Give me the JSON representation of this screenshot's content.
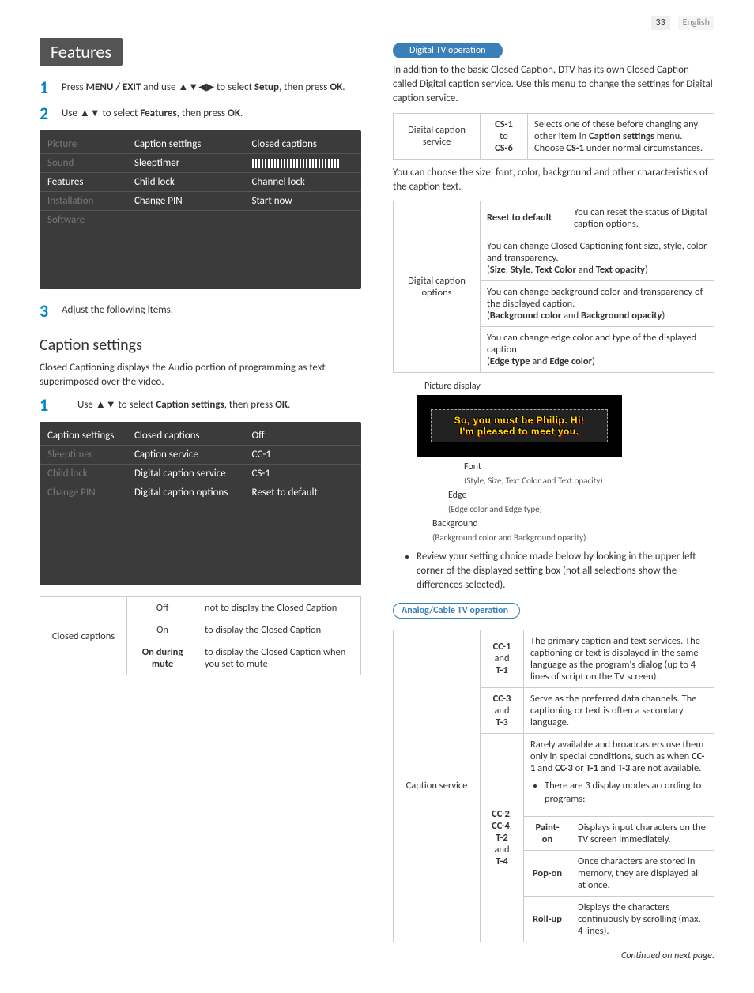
{
  "page": {
    "number": "33",
    "language": "English"
  },
  "left": {
    "features_title": "Features",
    "step1": {
      "text_a": "Press ",
      "bold_a": "MENU / EXIT",
      "text_b": " and use ",
      "arrows": "▲▼◀▶",
      "text_c": " to select ",
      "bold_b": "Setup",
      "text_d": ", then press ",
      "bold_c": "OK",
      "text_e": "."
    },
    "step2": {
      "text_a": "Use ",
      "arrows": "▲▼",
      "text_b": " to select ",
      "bold_a": "Features",
      "text_c": ", then press ",
      "bold_b": "OK",
      "text_d": "."
    },
    "menu1": {
      "r1": {
        "c1": "Picture",
        "c2": "Caption settings",
        "c3": "Closed captions"
      },
      "r2": {
        "c1": "Sound",
        "c2": "Sleeptimer"
      },
      "r3": {
        "c1": "Features",
        "c2": "Child lock",
        "c3": "Channel lock"
      },
      "r4": {
        "c1": "Installation",
        "c2": "Change PIN",
        "c3": "Start now"
      },
      "r5": {
        "c1": "Software"
      }
    },
    "step3": {
      "text": "Adjust the following items."
    },
    "caption_settings_title": "Caption settings",
    "caption_settings_intro": "Closed Captioning displays the Audio portion of programming as text superimposed over the video.",
    "caption_step1": {
      "text_a": "Use ",
      "arrows": "▲▼",
      "text_b": " to select ",
      "bold_a": "Caption settings",
      "text_c": ", then press ",
      "bold_b": "OK",
      "text_d": "."
    },
    "menu2": {
      "r1": {
        "c1": "Caption settings",
        "c2": "Closed captions",
        "c3": "Off"
      },
      "r2": {
        "c1": "Sleeptimer",
        "c2": "Caption service",
        "c3": "CC-1"
      },
      "r3": {
        "c1": "Child lock",
        "c2": "Digital caption service",
        "c3": "CS-1"
      },
      "r4": {
        "c1": "Change PIN",
        "c2": "Digital caption options",
        "c3": "Reset to default"
      }
    },
    "cc_table": {
      "header": "Closed captions",
      "rows": [
        {
          "opt": "Off",
          "desc": "not to display the Closed Caption"
        },
        {
          "opt": "On",
          "desc": "to display the Closed Caption"
        },
        {
          "opt": "On during mute",
          "desc": "to display the Closed Caption when you set to mute"
        }
      ]
    }
  },
  "right": {
    "digital_pill": "Digital TV operation",
    "digital_intro": "In addition to the basic Closed Caption, DTV has its own Closed Caption called Digital caption service. Use this menu to change the settings for Digital caption service.",
    "dcs_table": {
      "label": "Digital caption service",
      "val1": "CS-1",
      "val_mid": "to",
      "val2": "CS-6",
      "desc_a": "Selects one of these before changing any other item in ",
      "desc_b": "Caption settings",
      "desc_c": " menu. Choose ",
      "desc_d": "CS-1",
      "desc_e": " under normal circumstances."
    },
    "char_intro": "You can choose the size, font, color, background and other characteristics of the caption text.",
    "dco_table": {
      "label": "Digital caption options",
      "r1": {
        "a": "Reset to default",
        "b": "You can reset the status of Digital caption options."
      },
      "r2": {
        "text_a": "You can change Closed Captioning font size, style, color and transparency.",
        "text_b": "(",
        "b1": "Size",
        "s1": ", ",
        "b2": "Style",
        "s2": ", ",
        "b3": "Text Color",
        "s3": " and ",
        "b4": "Text opacity",
        "text_c": ")"
      },
      "r3": {
        "text_a": "You can change background color and transparency of the displayed caption.",
        "text_b": "(",
        "b1": "Background color",
        "s1": " and ",
        "b2": "Background opacity",
        "text_c": ")"
      },
      "r4": {
        "text_a": "You can change edge color and type of the displayed caption.",
        "text_b": "(",
        "b1": "Edge type",
        "s1": " and ",
        "b2": "Edge color",
        "text_c": ")"
      }
    },
    "pic_display_label": "Picture display",
    "tv_line1": "So, you must be Philip. Hi!",
    "tv_line2": "I'm pleased to meet you.",
    "font_label": "Font",
    "font_note": "(Style, Size, Text Color and Text opacity)",
    "edge_label": "Edge",
    "edge_note": "(Edge color and Edge type)",
    "bg_label": "Background",
    "bg_note": "(Background color and Background opacity)",
    "review_bullet": "Review your setting choice made below by looking in the upper left corner of the displayed setting box (not all selections show the differences selected).",
    "analog_pill": "Analog/Cable TV operation",
    "cs_table": {
      "label": "Caption service",
      "r1": {
        "val": "CC-1\nand\nT-1",
        "val_a": "CC-1",
        "val_b": "and",
        "val_c": "T-1",
        "desc": "The primary caption and text services. The captioning or text is displayed in the same language as the program's dialog (up to 4 lines of script on the TV screen)."
      },
      "r2": {
        "val_a": "CC-3",
        "val_b": "and",
        "val_c": "T-3",
        "desc": "Serve as the preferred data channels. The captioning or text is often a secondary language."
      },
      "r3": {
        "val_a": "CC-2",
        "val_a2": ",",
        "val_b": "CC-4",
        "val_b2": ",",
        "val_c": "T-2",
        "val_d": "and",
        "val_e": "T-4",
        "desc_a": "Rarely available and broadcasters use them only in special conditions, such as when ",
        "d_b1": "CC-1",
        "d_s1": " and ",
        "d_b2": "CC-3",
        "d_s2": " or ",
        "d_b3": "T-1",
        "d_s3": " and ",
        "d_b4": "T-3",
        "desc_b": " are not available.",
        "bullet": "There are 3 display modes according to programs:",
        "modes": [
          {
            "name": "Paint-on",
            "desc": "Displays input characters on the TV screen immediately."
          },
          {
            "name": "Pop-on",
            "desc": "Once characters are stored in memory, they are displayed all at once."
          },
          {
            "name": "Roll-up",
            "desc": "Displays the characters continuously by scrolling (max. 4 lines)."
          }
        ]
      }
    },
    "continued": "Continued on next page."
  }
}
